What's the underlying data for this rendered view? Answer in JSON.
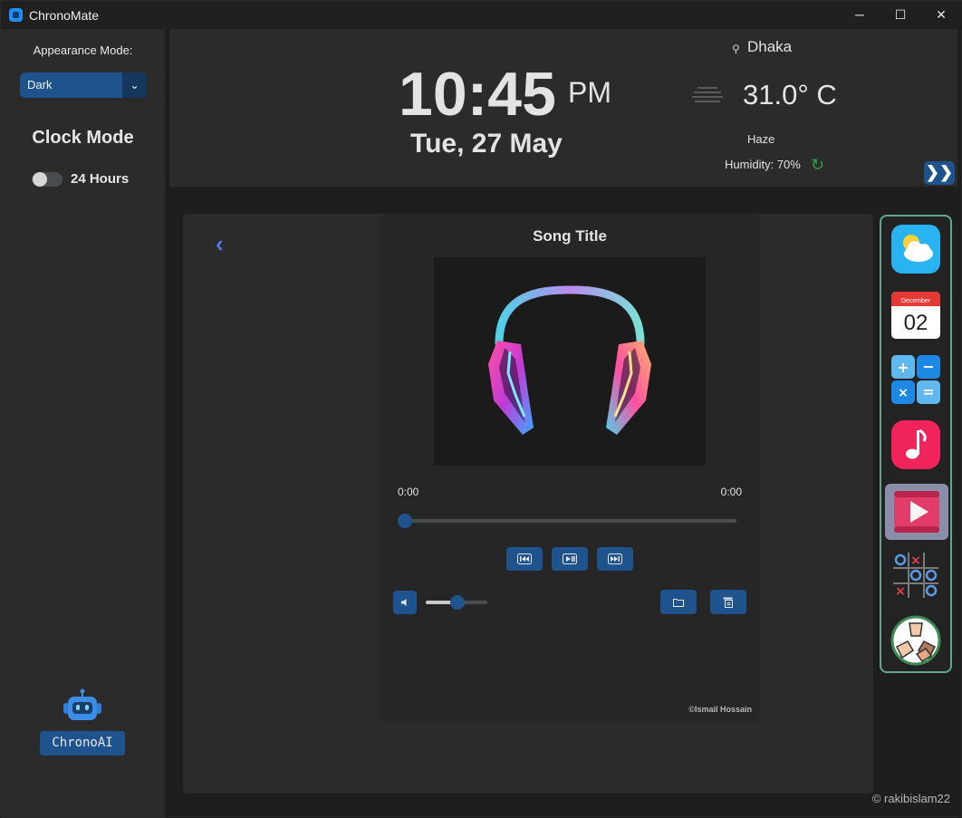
{
  "window": {
    "title": "ChronoMate",
    "minimize": "─",
    "maximize": "☐",
    "close": "✕"
  },
  "sidebar": {
    "appearance_label": "Appearance Mode:",
    "appearance_value": "Dark",
    "clock_mode_title": "Clock Mode",
    "clock_toggle_label": "24 Hours",
    "clock_toggle_on": false,
    "ai_button_label": "ChronoAI"
  },
  "header": {
    "time": "10:45",
    "ampm": "PM",
    "date": "Tue, 27 May",
    "city": "Dhaka",
    "temperature": "31.0° C",
    "condition": "Haze",
    "humidity": "Humidity: 70%",
    "expand_label": "❯❯"
  },
  "player": {
    "back_label": "‹",
    "song_title": "Song Title",
    "current_time": "0:00",
    "total_time": "0:00",
    "progress": 0,
    "volume": 0.5,
    "credit": "©Ismail Hossain"
  },
  "dock": {
    "apps": [
      "weather-app",
      "calendar-app",
      "calculator-app",
      "music-app",
      "video-player-app",
      "tic-tac-toe-app",
      "hands-game-app"
    ],
    "calendar_month": "December",
    "calendar_day": "02",
    "active_app": "video-player-app"
  },
  "footer": {
    "credit": "© rakibislam22"
  },
  "colors": {
    "accent": "#1f538d",
    "background": "#1e1e1e",
    "panel": "#2b2b2b",
    "dock_border": "#5fa88a"
  }
}
